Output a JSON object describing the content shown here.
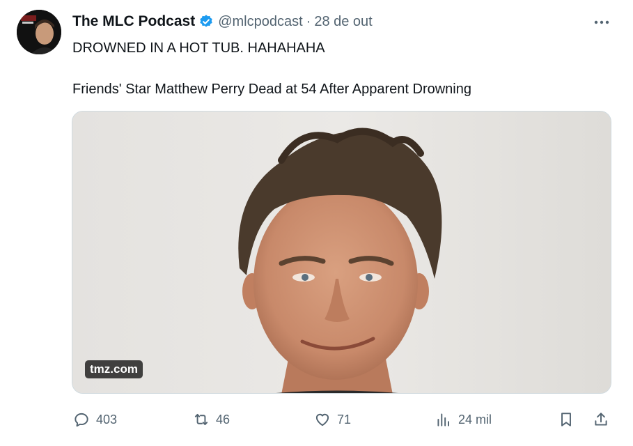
{
  "tweet": {
    "author": {
      "display_name": "The MLC Podcast",
      "handle": "@mlcpodcast",
      "separator": "·",
      "date": "28 de out",
      "verified": true,
      "avatar_icon": "avatar-photo"
    },
    "text_line1": "DROWNED IN A HOT TUB. HAHAHAHA",
    "text_line2": "Friends' Star Matthew Perry Dead at 54 After Apparent Drowning",
    "media": {
      "source_label": "tmz.com",
      "image_icon": "portrait-photo"
    },
    "actions": {
      "replies": "403",
      "reposts": "46",
      "likes": "71",
      "views": "24 mil",
      "reply_icon": "reply-icon",
      "repost_icon": "repost-icon",
      "like_icon": "heart-icon",
      "views_icon": "views-icon",
      "bookmark_icon": "bookmark-icon",
      "share_icon": "share-icon"
    },
    "colors": {
      "text": "#0f1419",
      "secondary": "#536471",
      "verified": "#1d9bf0",
      "border": "#cfd9de"
    }
  }
}
